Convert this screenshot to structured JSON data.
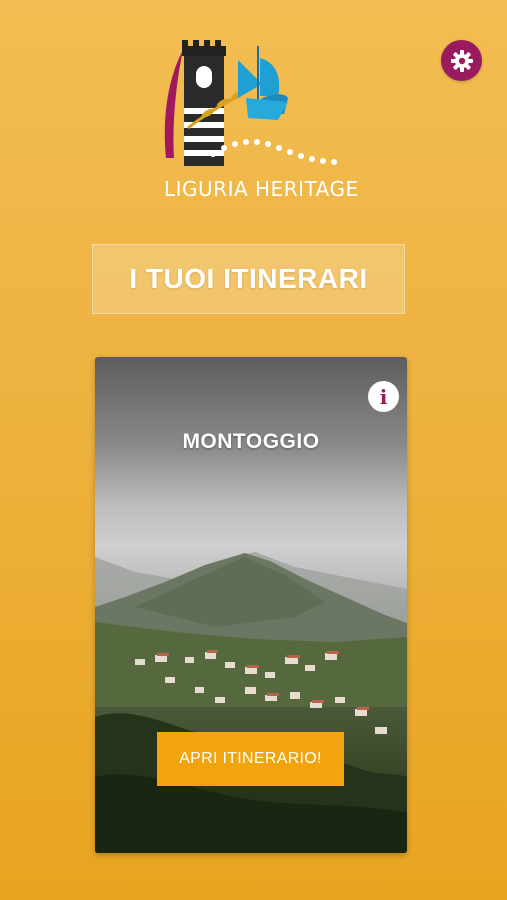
{
  "app": {
    "logo_text": "LIGURIA HERITAGE",
    "icons": {
      "settings": "gear-icon",
      "info": "info-icon"
    },
    "colors": {
      "background": "#eeb23f",
      "accent": "#9a1a5e",
      "button": "#f2a40f"
    }
  },
  "header": {
    "section_title": "I TUOI ITINERARI"
  },
  "itinerary_card": {
    "title": "MONTOGGIO",
    "info_glyph": "i",
    "open_button_label": "APRI ITINERARIO!"
  }
}
